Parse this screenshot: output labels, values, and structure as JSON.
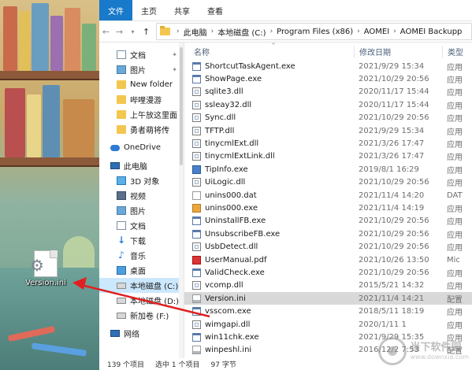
{
  "desktop": {
    "icon_label": "Version.ini"
  },
  "ribbon": {
    "tabs": [
      "文件",
      "主页",
      "共享",
      "查看"
    ]
  },
  "address": {
    "path": [
      "此电脑",
      "本地磁盘 (C:)",
      "Program Files (x86)",
      "AOMEI",
      "AOMEI Backupp"
    ]
  },
  "nav": {
    "items": [
      {
        "label": "文档",
        "icon": "document-icon",
        "pinned": true
      },
      {
        "label": "图片",
        "icon": "pictures-icon",
        "pinned": true
      },
      {
        "label": "New folder",
        "icon": "folder-icon",
        "pinned": false
      },
      {
        "label": "哔哩漫游",
        "icon": "folder-icon",
        "pinned": false
      },
      {
        "label": "上午放这里面",
        "icon": "folder-icon",
        "pinned": false
      },
      {
        "label": "勇者萌将传",
        "icon": "folder-icon",
        "pinned": false
      },
      {
        "label": "OneDrive",
        "icon": "onedrive-icon",
        "pinned": false
      },
      {
        "label": "此电脑",
        "icon": "computer-icon",
        "pinned": false
      },
      {
        "label": "3D 对象",
        "icon": "3d-objects-icon",
        "pinned": false
      },
      {
        "label": "视频",
        "icon": "videos-icon",
        "pinned": false
      },
      {
        "label": "图片",
        "icon": "pictures-icon",
        "pinned": false
      },
      {
        "label": "文档",
        "icon": "document-icon",
        "pinned": false
      },
      {
        "label": "下载",
        "icon": "downloads-icon",
        "pinned": false
      },
      {
        "label": "音乐",
        "icon": "music-icon",
        "pinned": false
      },
      {
        "label": "桌面",
        "icon": "desktop-icon",
        "pinned": false
      },
      {
        "label": "本地磁盘 (C:)",
        "icon": "drive-icon",
        "pinned": false
      },
      {
        "label": "本地磁盘 (D:)",
        "icon": "drive-icon",
        "pinned": false
      },
      {
        "label": "新加卷 (F:)",
        "icon": "drive-icon",
        "pinned": false
      },
      {
        "label": "网络",
        "icon": "network-icon",
        "pinned": false
      }
    ]
  },
  "columns": {
    "name": "名称",
    "date": "修改日期",
    "type": "类型"
  },
  "files": [
    {
      "name": "ShortcutTaskAgent.exe",
      "date": "2021/9/29 15:34",
      "type": "应用",
      "kind": "exe"
    },
    {
      "name": "ShowPage.exe",
      "date": "2021/10/29 20:56",
      "type": "应用",
      "kind": "exe"
    },
    {
      "name": "sqlite3.dll",
      "date": "2020/11/17 15:44",
      "type": "应用",
      "kind": "dll"
    },
    {
      "name": "ssleay32.dll",
      "date": "2020/11/17 15:44",
      "type": "应用",
      "kind": "dll"
    },
    {
      "name": "Sync.dll",
      "date": "2021/10/29 20:56",
      "type": "应用",
      "kind": "dll"
    },
    {
      "name": "TFTP.dll",
      "date": "2021/9/29 15:34",
      "type": "应用",
      "kind": "dll"
    },
    {
      "name": "tinycmlExt.dll",
      "date": "2021/3/26 17:47",
      "type": "应用",
      "kind": "dll"
    },
    {
      "name": "tinycmlExtLink.dll",
      "date": "2021/3/26 17:47",
      "type": "应用",
      "kind": "dll"
    },
    {
      "name": "TipInfo.exe",
      "date": "2019/8/1 16:29",
      "type": "应用",
      "kind": "color"
    },
    {
      "name": "UiLogic.dll",
      "date": "2021/10/29 20:56",
      "type": "应用",
      "kind": "dll"
    },
    {
      "name": "unins000.dat",
      "date": "2021/11/4 14:20",
      "type": "DAT",
      "kind": "dat"
    },
    {
      "name": "unins000.exe",
      "date": "2021/11/4 14:19",
      "type": "应用",
      "kind": "orange"
    },
    {
      "name": "UninstallFB.exe",
      "date": "2021/10/29 20:56",
      "type": "应用",
      "kind": "exe"
    },
    {
      "name": "UnsubscribeFB.exe",
      "date": "2021/10/29 20:56",
      "type": "应用",
      "kind": "exe"
    },
    {
      "name": "UsbDetect.dll",
      "date": "2021/10/29 20:56",
      "type": "应用",
      "kind": "dll"
    },
    {
      "name": "UserManual.pdf",
      "date": "2021/10/26 13:50",
      "type": "Mic",
      "kind": "pdf"
    },
    {
      "name": "ValidCheck.exe",
      "date": "2021/10/29 20:56",
      "type": "应用",
      "kind": "exe"
    },
    {
      "name": "vcomp.dll",
      "date": "2015/5/21 14:32",
      "type": "应用",
      "kind": "dll"
    },
    {
      "name": "Version.ini",
      "date": "2021/11/4 14:21",
      "type": "配置",
      "kind": "ini",
      "selected": true
    },
    {
      "name": "vsscom.exe",
      "date": "2018/5/11 18:19",
      "type": "应用",
      "kind": "exe"
    },
    {
      "name": "wimgapi.dll",
      "date": "2020/1/11 1",
      "type": "应用",
      "kind": "dll"
    },
    {
      "name": "win11chk.exe",
      "date": "2021/9/29 15:35",
      "type": "应用",
      "kind": "exe"
    },
    {
      "name": "winpeshl.ini",
      "date": "2016/12/2 7:53",
      "type": "配置",
      "kind": "ini"
    }
  ],
  "status": {
    "count": "139 个项目",
    "selected": "选中 1 个项目",
    "size": "97 字节"
  },
  "watermark": {
    "text": "当下软件园",
    "url": "www.downxia.com"
  },
  "colors": {
    "file_tab": "#1979ca",
    "selection": "#cce8ff",
    "arrow": "#e02020"
  }
}
